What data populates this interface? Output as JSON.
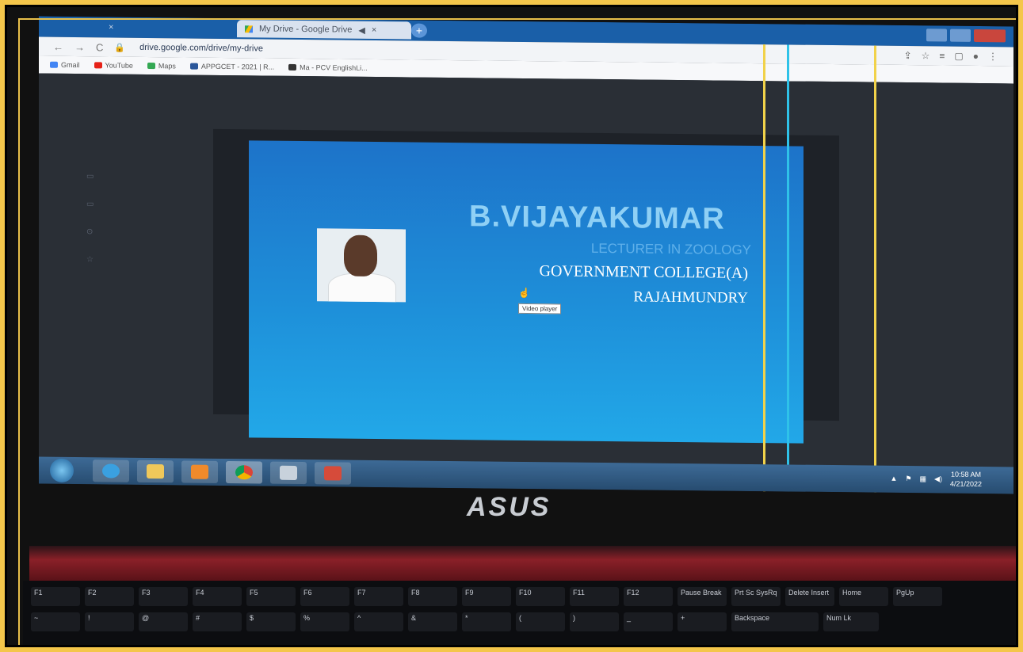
{
  "browser": {
    "tabs": [
      {
        "label": "",
        "close": "×"
      },
      {
        "label": "My Drive - Google Drive",
        "close": "×"
      }
    ],
    "new_tab": "+",
    "nav": {
      "back": "←",
      "forward": "→",
      "reload": "C"
    },
    "url": "drive.google.com/drive/my-drive",
    "bookmarks": [
      {
        "label": "Gmail",
        "color": "#4285f4"
      },
      {
        "label": "YouTube",
        "color": "#e62117"
      },
      {
        "label": "Maps",
        "color": "#34a853"
      },
      {
        "label": "APPGCET - 2021 | R...",
        "color": "#2b579a"
      },
      {
        "label": "Ma - PCV EnglishLi...",
        "color": "#333333"
      }
    ]
  },
  "slide": {
    "name": "B.VIJAYAKUMAR",
    "role": "LECTURER IN ZOOLOGY",
    "college": "GOVERNMENT COLLEGE(A)",
    "city": "RAJAHMUNDRY",
    "tooltip": "Video player"
  },
  "taskbar": {
    "items": [
      {
        "name": "ie-icon",
        "color": "#3aa0e0"
      },
      {
        "name": "folder-icon",
        "color": "#f0c85a"
      },
      {
        "name": "media-player-icon",
        "color": "#f08a2a"
      },
      {
        "name": "chrome-icon",
        "color": "#4caf50"
      },
      {
        "name": "app-icon",
        "color": "#c8d2dc"
      },
      {
        "name": "presentation-icon",
        "color": "#d64b3a"
      }
    ],
    "time": "10:58 AM",
    "date": "4/21/2022"
  },
  "laptop": {
    "brand": "ASUS"
  },
  "keyboard": {
    "fn_row": [
      "F1",
      "F2",
      "F3",
      "F4",
      "F5",
      "F6",
      "F7",
      "F8",
      "F9",
      "F10",
      "F11",
      "F12",
      "Pause Break",
      "Prt Sc SysRq",
      "Delete Insert",
      "Home",
      "PgUp"
    ],
    "num_row": [
      "~",
      "!",
      "@",
      "#",
      "$",
      "%",
      "^",
      "&",
      "*",
      "(",
      ")",
      "_",
      "+",
      "Backspace",
      "Num Lk"
    ]
  }
}
